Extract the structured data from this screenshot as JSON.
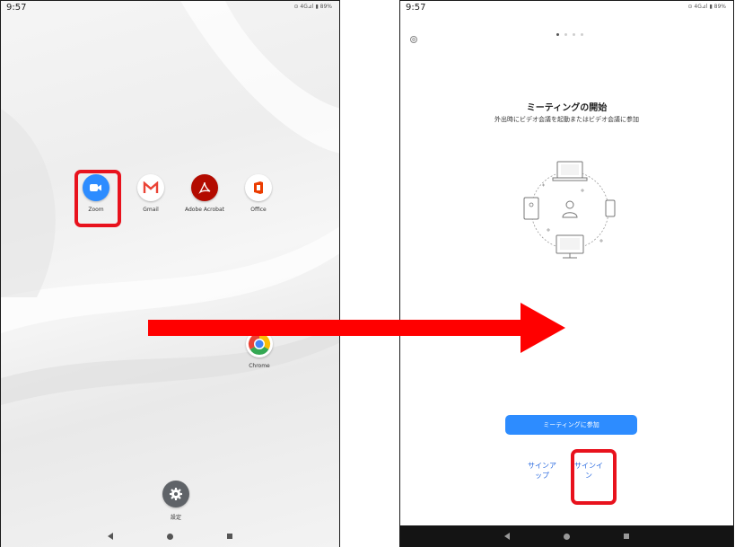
{
  "left_screen": {
    "status_time": "9:57",
    "status_right": "⊙ 4G⊿l  ▮ 89%",
    "apps": [
      {
        "label": "Zoom",
        "icon": "zoom-video-icon",
        "color": "#2d8cff"
      },
      {
        "label": "Gmail",
        "icon": "gmail-icon",
        "color": "#ea4335"
      },
      {
        "label": "Adobe Acrobat",
        "icon": "acrobat-icon",
        "color": "#b30b00"
      },
      {
        "label": "Office",
        "icon": "office-icon",
        "color": "#eb3c00"
      }
    ],
    "chrome_label": "Chrome",
    "settings_label": "設定"
  },
  "right_screen": {
    "status_time": "9:57",
    "status_right": "⊙ 4G⊿l  ▮ 89%",
    "title": "ミーティングの開始",
    "subtitle": "外出時にビデオ会議を起動またはビデオ会議に参加",
    "join_button": "ミーティングに参加",
    "sign_up": "サインアップ",
    "sign_in": "サインイン"
  },
  "colors": {
    "highlight": "#e8121d",
    "arrow": "#ff0000",
    "zoom_blue": "#2d8cff"
  }
}
